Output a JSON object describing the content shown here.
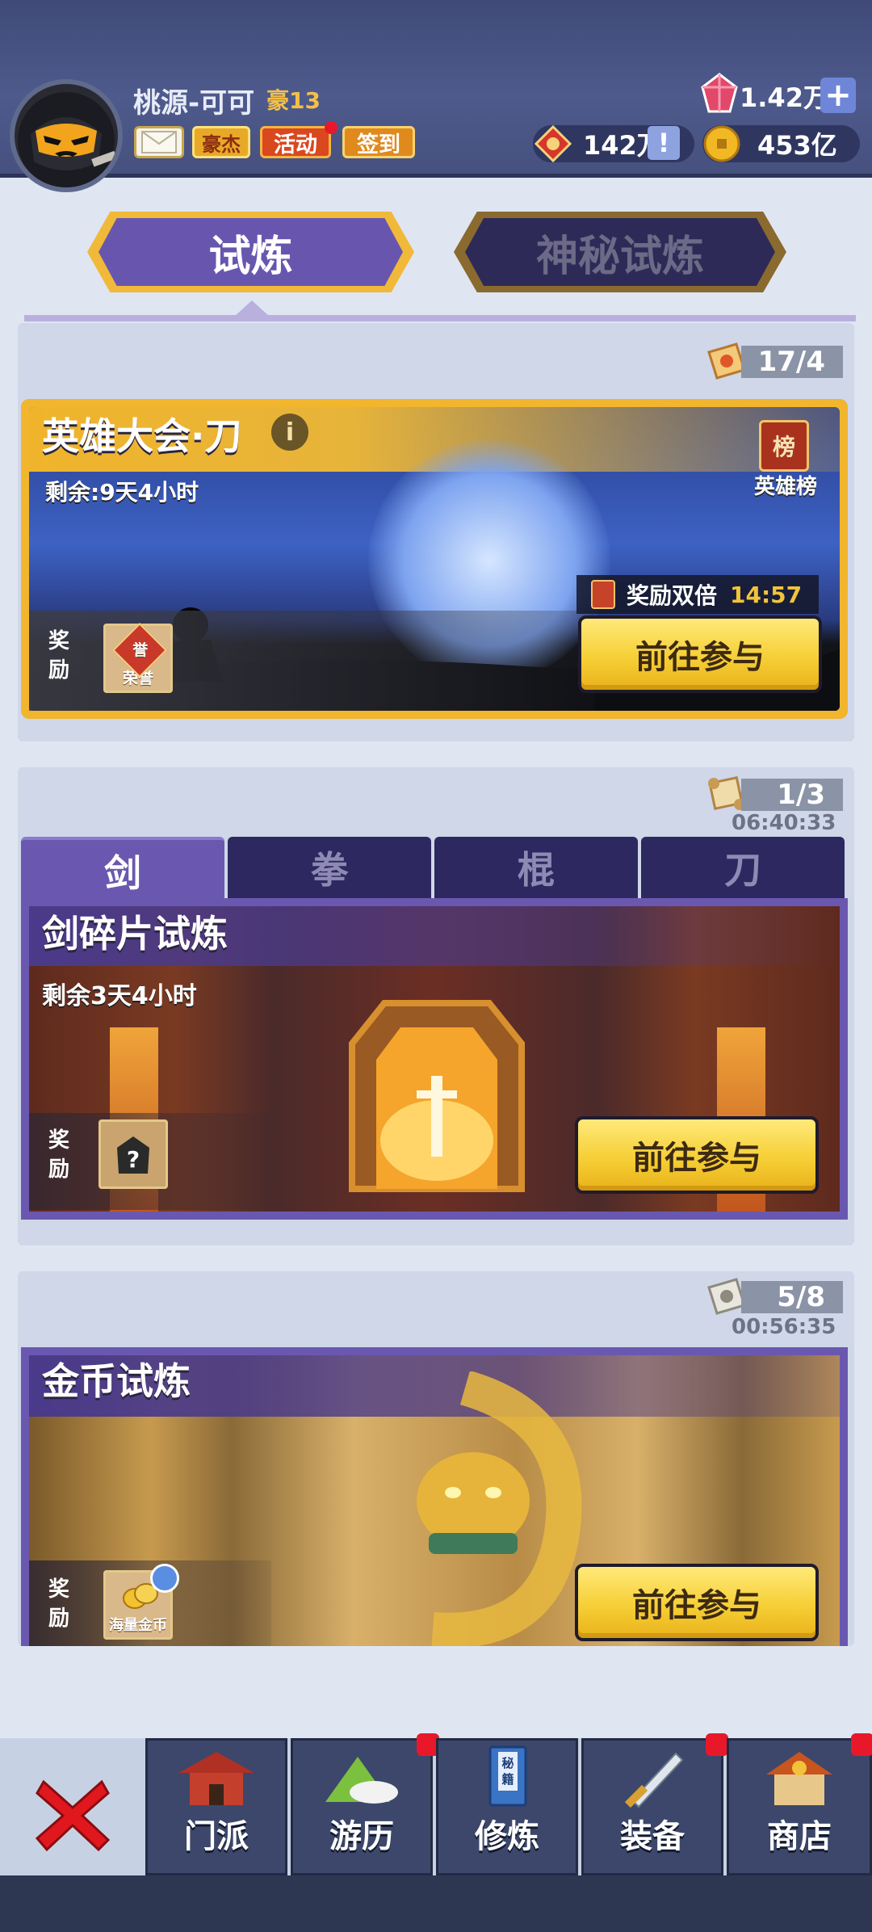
{
  "header": {
    "username": "桃源-可可",
    "vip_label": "豪13",
    "buttons": {
      "hero": "豪杰",
      "event": "活动",
      "signin": "签到"
    },
    "currencies": {
      "gems": "1.42万",
      "honor": "142万",
      "coins": "453亿"
    }
  },
  "tabs": {
    "trial": "试炼",
    "mystery": "神秘试炼"
  },
  "hero_event": {
    "counter": "17/4",
    "title": "英雄大会·刀",
    "remaining": "剩余:9天4小时",
    "leaderboard_badge": "榜",
    "leaderboard_label": "英雄榜",
    "double_label": "奖励双倍",
    "double_timer": "14:57",
    "reward_label": "奖励",
    "reward_item_badge": "誉",
    "reward_item": "荣誉",
    "go_button": "前往参与"
  },
  "fragment_trial": {
    "counter": "1/3",
    "timer": "06:40:33",
    "weapon_tabs": [
      "剑",
      "拳",
      "棍",
      "刀"
    ],
    "title": "剑碎片试炼",
    "remaining": "剩余3天4小时",
    "reward_label": "奖励",
    "reward_item_mark": "?",
    "go_button": "前往参与"
  },
  "coin_trial": {
    "counter": "5/8",
    "timer": "00:56:35",
    "title": "金币试炼",
    "reward_label": "奖励",
    "reward_item": "海量金币",
    "go_button": "前往参与"
  },
  "bottom_nav": {
    "items": [
      "门派",
      "游历",
      "修炼",
      "装备",
      "商店"
    ],
    "cultivate_book_label": "秘籍"
  },
  "colors": {
    "header": "#46517f",
    "accent_purple": "#6a58b0",
    "button_yellow": "#f6cf36",
    "notification_red": "#e8182a"
  }
}
